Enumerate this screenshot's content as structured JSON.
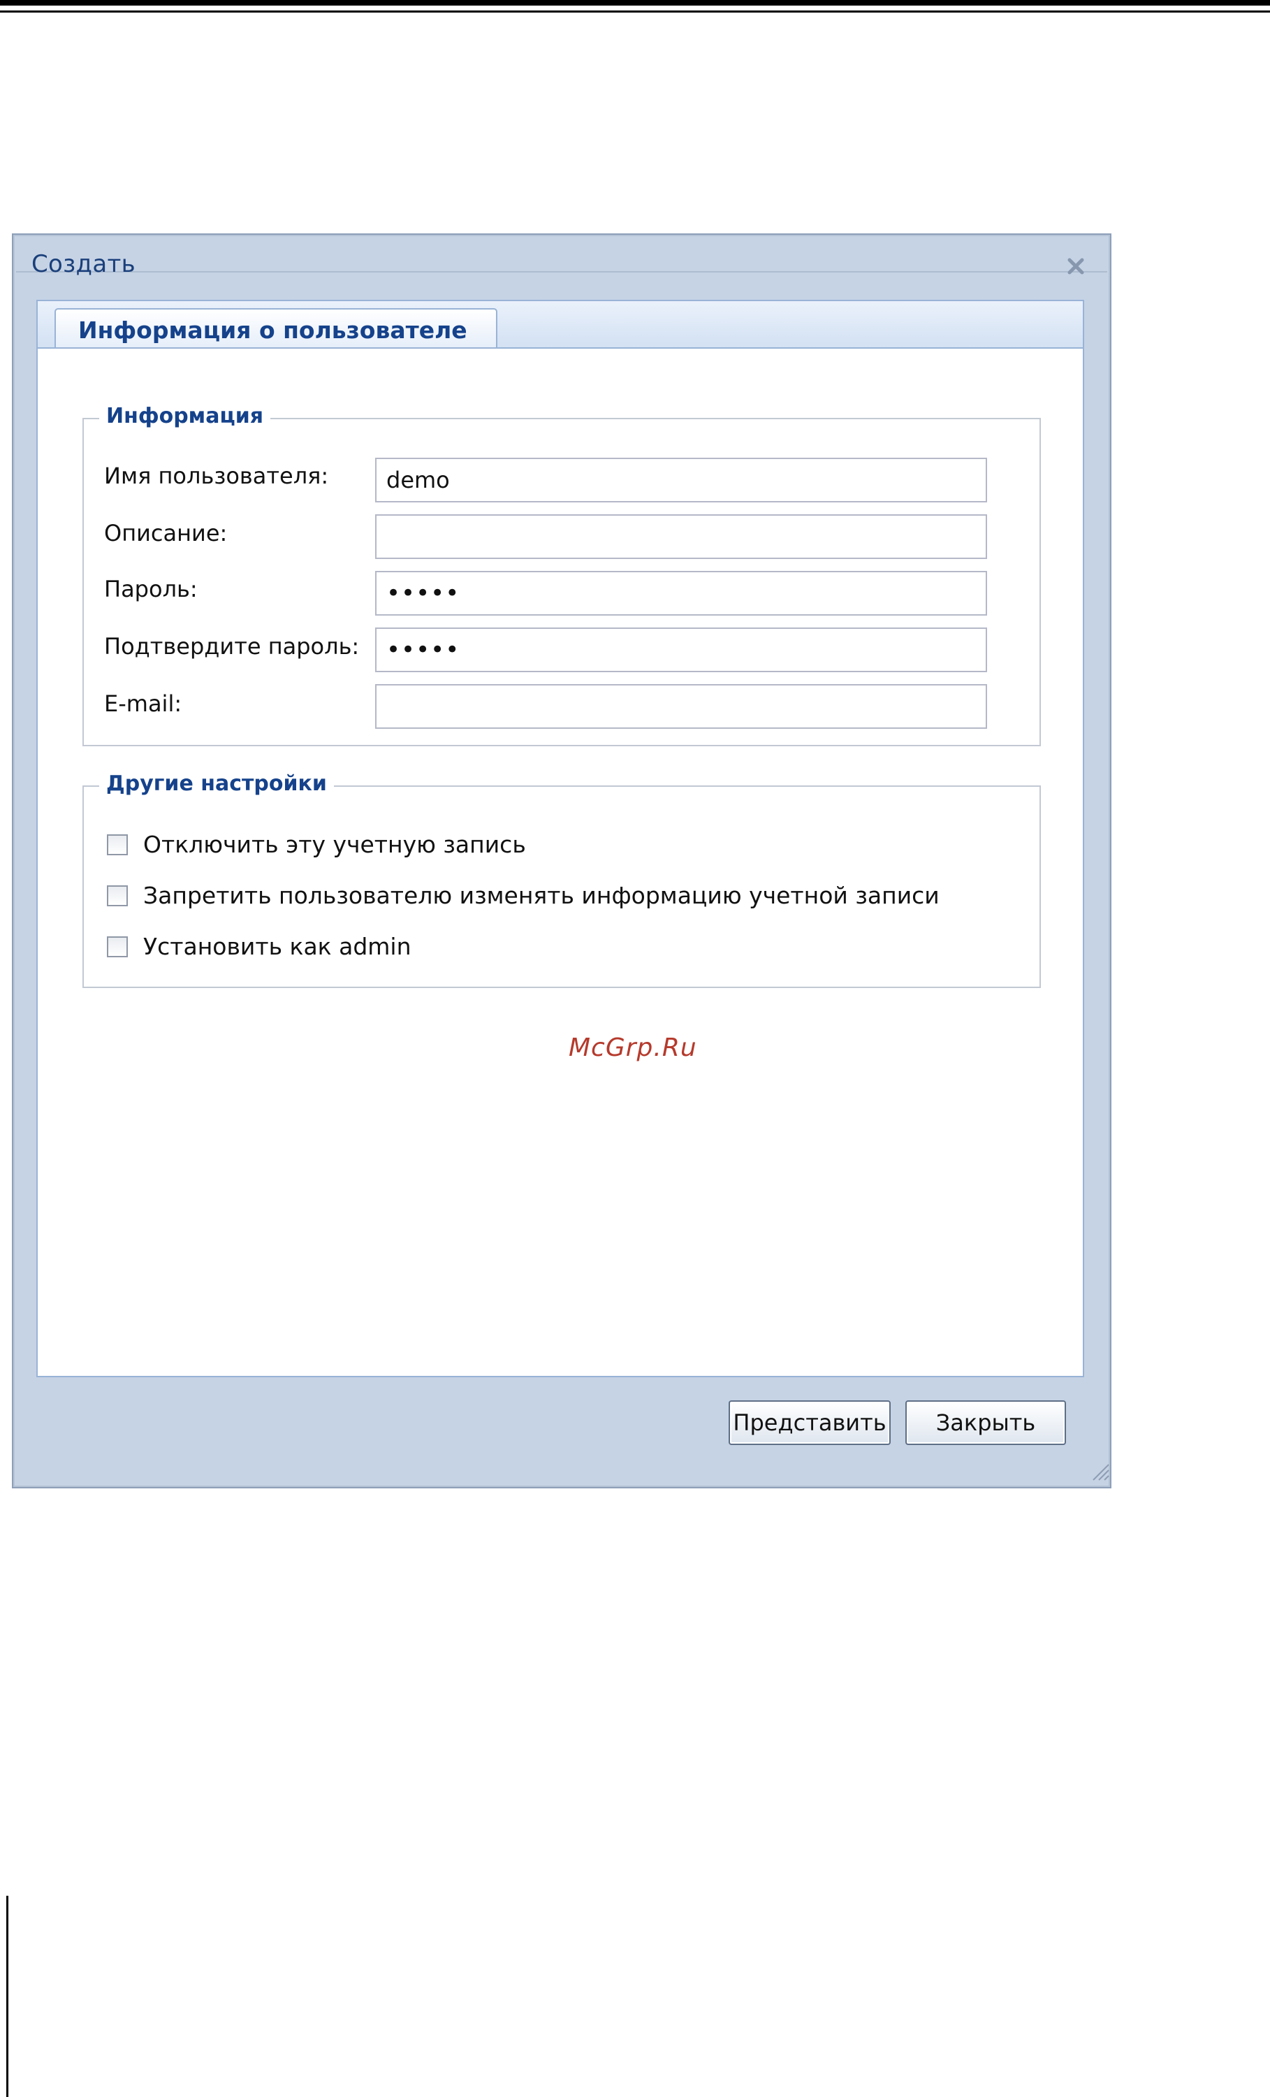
{
  "dialog": {
    "title": "Создать",
    "tab_label": "Информация о пользователе"
  },
  "info_section": {
    "legend": "Информация",
    "fields": [
      {
        "label": "Имя пользователя:",
        "value": "demo",
        "type": "text"
      },
      {
        "label": "Описание:",
        "value": "",
        "type": "text"
      },
      {
        "label": "Пароль:",
        "value": "•••••",
        "type": "password"
      },
      {
        "label": "Подтвердите пароль:",
        "value": "•••••",
        "type": "password"
      },
      {
        "label": "E-mail:",
        "value": "",
        "type": "text"
      }
    ]
  },
  "other_section": {
    "legend": "Другие настройки",
    "options": [
      {
        "label": "Отключить эту учетную запись",
        "checked": false
      },
      {
        "label": "Запретить пользователю изменять информацию учетной записи",
        "checked": false
      },
      {
        "label": "Установить как admin",
        "checked": false
      }
    ]
  },
  "watermark": "McGrp.Ru",
  "buttons": {
    "submit": "Представить",
    "close": "Закрыть"
  },
  "colors": {
    "title_blue": "#15428b",
    "dialog_bg": "#c6d3e5",
    "watermark_red": "#b53a2c"
  }
}
